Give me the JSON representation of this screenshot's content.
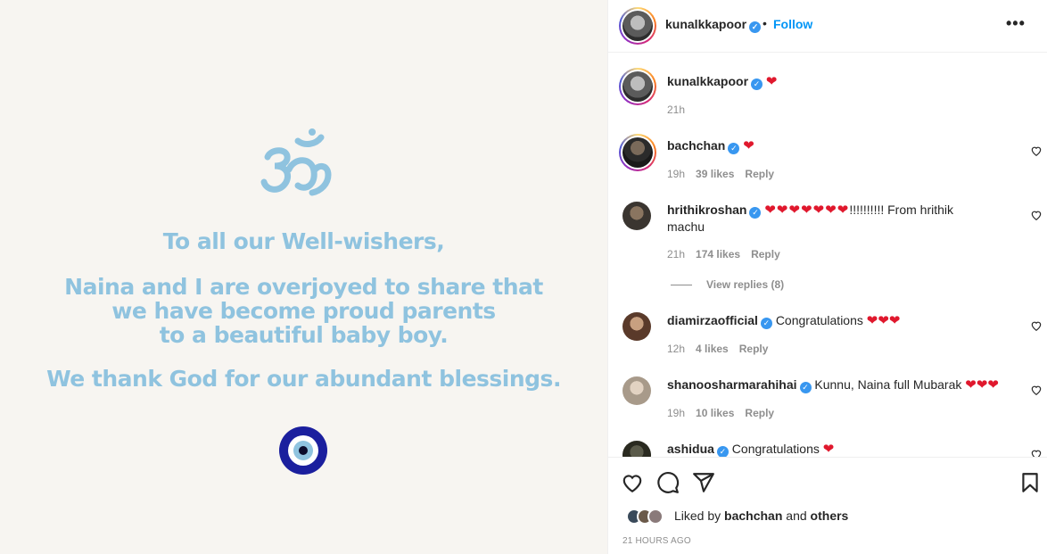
{
  "post": {
    "line1": "To all our Well-wishers,",
    "line2a": "Naina and I are overjoyed to share that",
    "line2b": "we have become proud parents",
    "line2c": "to a beautiful baby boy.",
    "line3": "We thank God for our abundant blessings."
  },
  "header": {
    "username": "kunalkkapoor",
    "separator": "•",
    "follow_label": "Follow",
    "more_label": "•••"
  },
  "caption": {
    "username": "kunalkkapoor",
    "text": "❤",
    "time": "21h"
  },
  "comments": [
    {
      "username": "bachchan",
      "text": "❤",
      "time": "19h",
      "likes": "39 likes",
      "reply": "Reply"
    },
    {
      "username": "hrithikroshan",
      "text": "❤❤❤❤❤❤❤!!!!!!!!!! From hrithik",
      "text2": "machu",
      "time": "21h",
      "likes": "174 likes",
      "reply": "Reply",
      "view_replies": "View replies (8)"
    },
    {
      "username": "diamirzaofficial",
      "text": "Congratulations ❤❤❤",
      "time": "12h",
      "likes": "4 likes",
      "reply": "Reply"
    },
    {
      "username": "shanoosharmarahihai",
      "text": "Kunnu, Naina full Mubarak ❤❤❤",
      "time": "19h",
      "likes": "10 likes",
      "reply": "Reply"
    },
    {
      "username": "ashidua",
      "text": "Congratulations ❤"
    }
  ],
  "footer": {
    "liked_by_prefix": "Liked by",
    "liked_by_user": "bachchan",
    "liked_by_and": "and",
    "liked_by_others": "others",
    "time_ago": "21 HOURS AGO"
  },
  "colors": {
    "accent": "#0095f6",
    "heart": "#e0182d",
    "verified": "#3897f0",
    "post_text": "#8fc3df"
  },
  "icons": [
    "om-symbol",
    "evil-eye",
    "verified-badge",
    "heart-icon",
    "comment-icon",
    "share-icon",
    "bookmark-icon",
    "more-icon"
  ]
}
